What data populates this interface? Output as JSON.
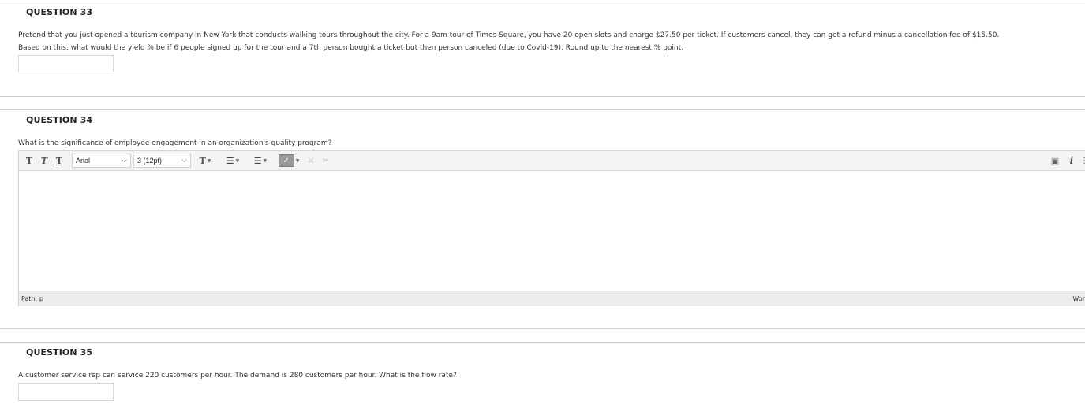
{
  "q33": {
    "title": "QUESTION 33",
    "text_line1": "Pretend that you just opened a tourism company in New York that conducts walking tours throughout the city. For a 9am tour of Times Square, you have 20 open slots and charge $27.50 per ticket. If customers cancel, they can get a refund minus a cancellation fee of $15.50.",
    "text_line2": "Based on this, what would the yield % be if 6 people signed up for the tour and a 7th person bought a ticket but then person canceled (due to Covid-19). Round up to the nearest % point.",
    "answer_value": ""
  },
  "q34": {
    "title": "QUESTION 34",
    "text": "What is the significance of employee engagement in an organization's quality program?",
    "editor": {
      "font_family_value": "Arial",
      "font_size_value": "3 (12pt)",
      "path_label": "Path: p",
      "word_count_label": "Wor",
      "body_text": ""
    }
  },
  "q35": {
    "title": "QUESTION 35",
    "text": "A customer service rep can service 220 customers per hour. The demand is 280 customers per hour. What is the flow rate?",
    "answer_value": ""
  }
}
